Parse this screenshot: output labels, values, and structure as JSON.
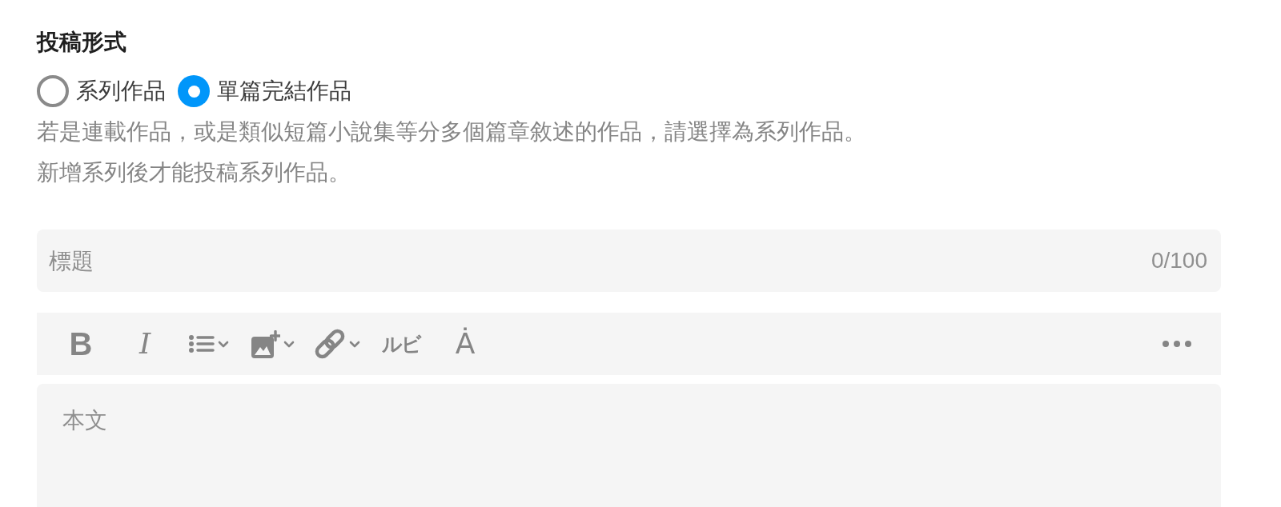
{
  "section": {
    "heading": "投稿形式",
    "options": [
      {
        "label": "系列作品",
        "selected": false
      },
      {
        "label": "單篇完結作品",
        "selected": true
      }
    ],
    "help": [
      "若是連載作品，或是類似短篇小說集等分多個篇章敘述的作品，請選擇為系列作品。",
      "新增系列後才能投稿系列作品。"
    ]
  },
  "title_field": {
    "placeholder": "標題",
    "counter": "0/100"
  },
  "toolbar": {
    "items": [
      {
        "kind": "bold",
        "label": "B",
        "dropdown": false
      },
      {
        "kind": "italic",
        "label": "I",
        "dropdown": false
      },
      {
        "kind": "list",
        "dropdown": true
      },
      {
        "kind": "image",
        "dropdown": true
      },
      {
        "kind": "link",
        "dropdown": true
      },
      {
        "kind": "ruby",
        "label": "ルビ",
        "dropdown": false
      },
      {
        "kind": "emphasis",
        "label": "Ȧ",
        "dropdown": false
      },
      {
        "kind": "more",
        "dropdown": false
      }
    ]
  },
  "body_field": {
    "placeholder": "本文"
  }
}
